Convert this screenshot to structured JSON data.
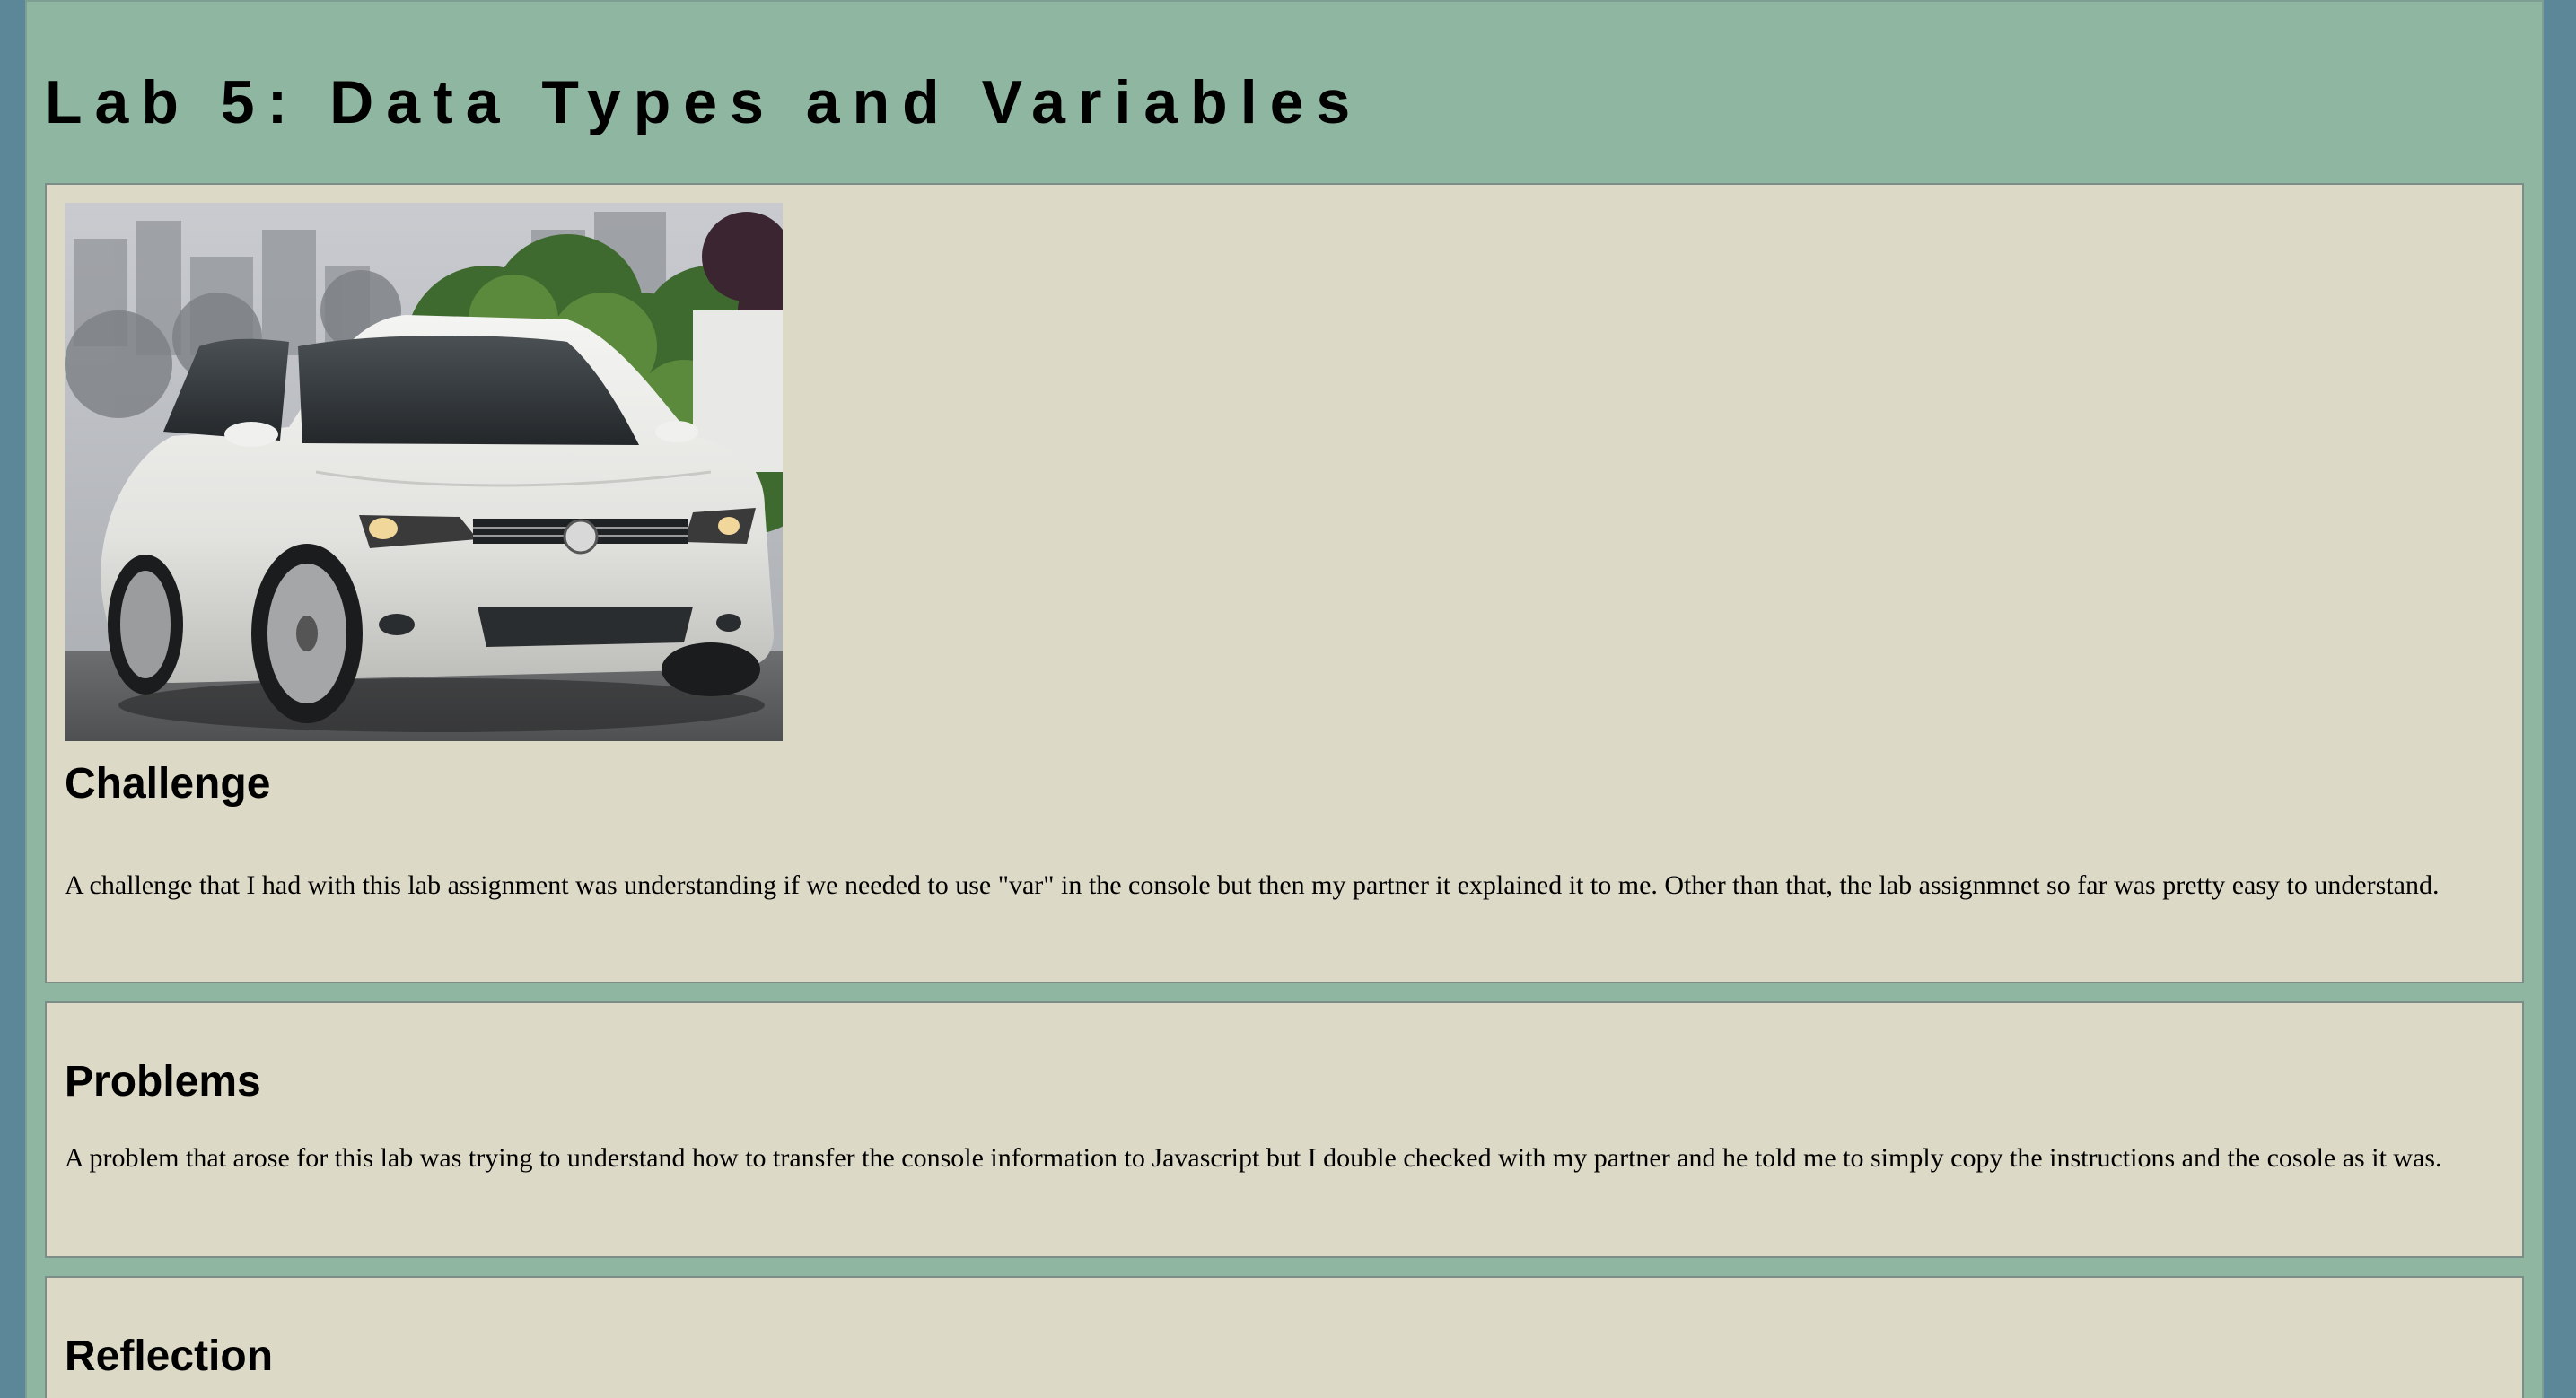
{
  "page": {
    "title": "Lab 5: Data Types and Variables"
  },
  "colors": {
    "outer_background": "#5c8799",
    "page_background": "#8fb6a1",
    "section_background": "#dcd9c6",
    "section_border": "#7c8c86"
  },
  "sections": [
    {
      "heading": "Challenge",
      "text": "A challenge that I had with this lab assignment was understanding if we needed to use \"var\" in the console but then my partner it explained it to me. Other than that, the lab assignmnet so far was pretty easy to understand."
    },
    {
      "heading": "Problems",
      "text": "A problem that arose for this lab was trying to understand how to transfer the console information to Javascript but I double checked with my partner and he told me to simply copy the instructions and the cosole as it was."
    },
    {
      "heading": "Reflection"
    }
  ]
}
